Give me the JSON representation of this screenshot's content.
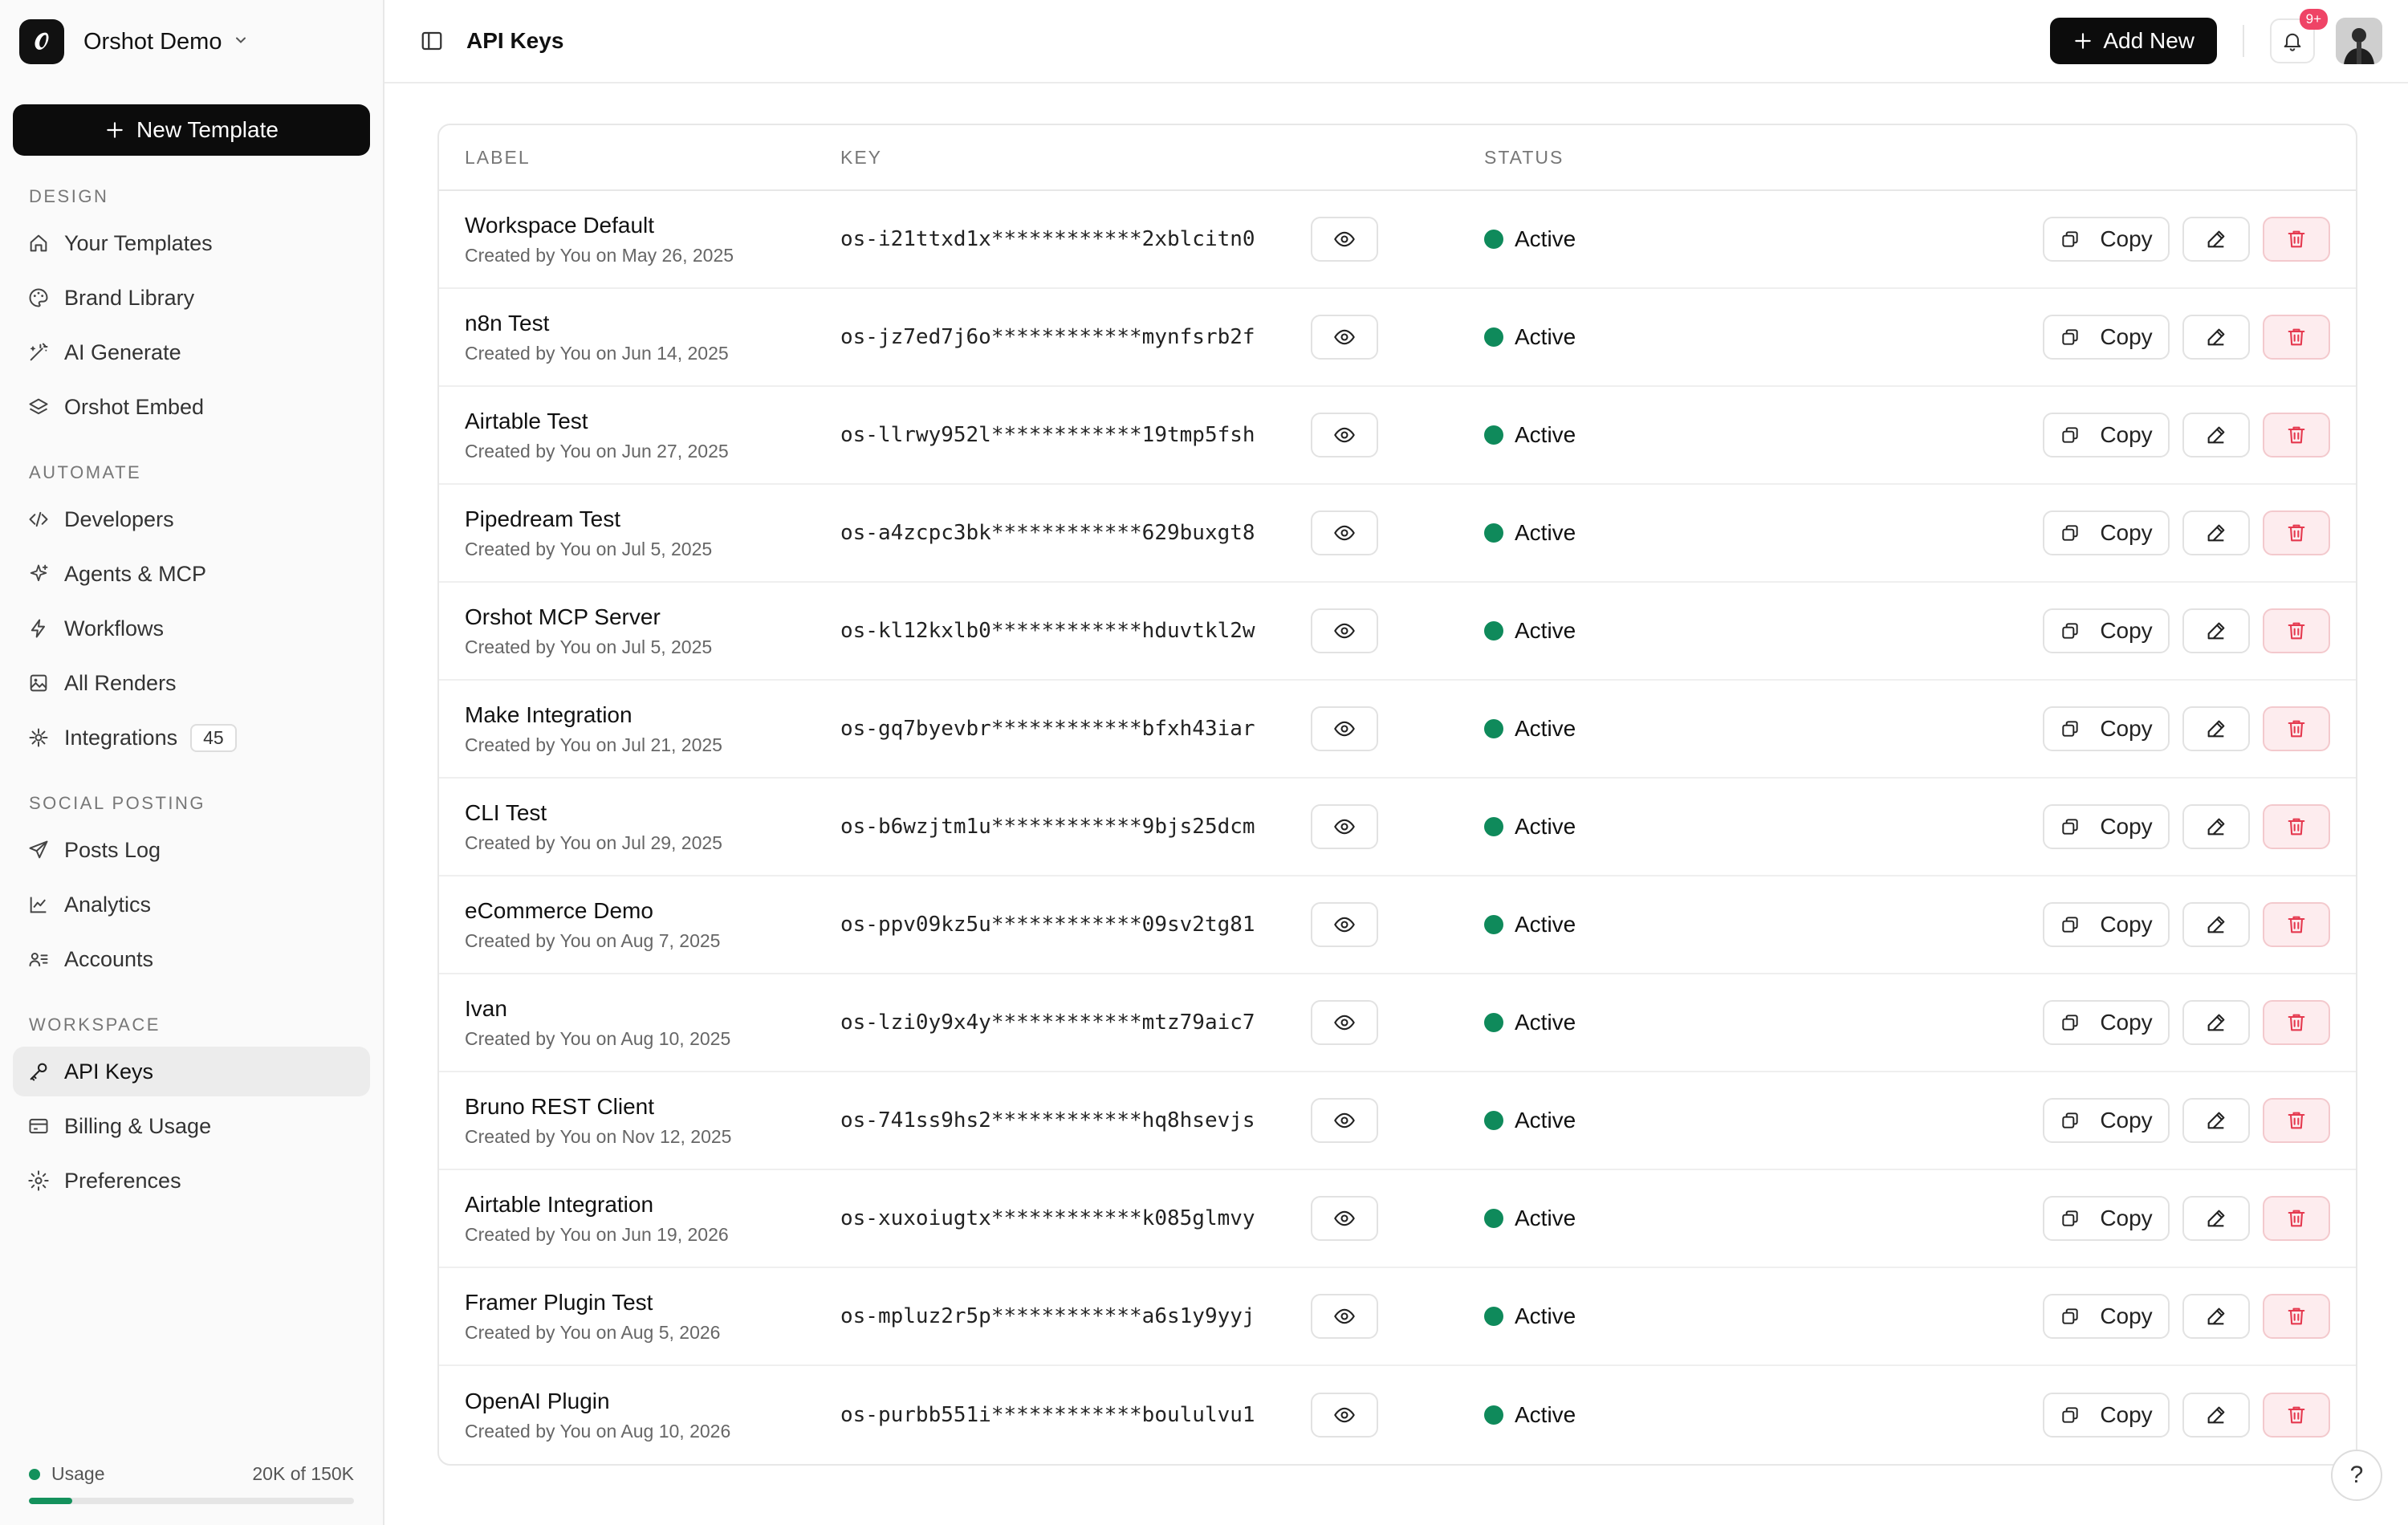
{
  "workspace": {
    "name": "Orshot Demo"
  },
  "sidebar": {
    "new_template_label": "New Template",
    "sections": [
      {
        "title": "DESIGN",
        "items": [
          {
            "label": "Your Templates",
            "icon": "home-icon"
          },
          {
            "label": "Brand Library",
            "icon": "palette-icon"
          },
          {
            "label": "AI Generate",
            "icon": "wand-icon"
          },
          {
            "label": "Orshot Embed",
            "icon": "layers-icon"
          }
        ]
      },
      {
        "title": "AUTOMATE",
        "items": [
          {
            "label": "Developers",
            "icon": "code-icon"
          },
          {
            "label": "Agents & MCP",
            "icon": "sparkles-icon"
          },
          {
            "label": "Workflows",
            "icon": "zap-icon"
          },
          {
            "label": "All Renders",
            "icon": "image-icon"
          },
          {
            "label": "Integrations",
            "icon": "plug-icon",
            "badge": "45"
          }
        ]
      },
      {
        "title": "SOCIAL POSTING",
        "items": [
          {
            "label": "Posts Log",
            "icon": "send-icon"
          },
          {
            "label": "Analytics",
            "icon": "chart-icon"
          },
          {
            "label": "Accounts",
            "icon": "users-icon"
          }
        ]
      },
      {
        "title": "WORKSPACE",
        "items": [
          {
            "label": "API Keys",
            "icon": "key-icon",
            "active": true
          },
          {
            "label": "Billing & Usage",
            "icon": "card-icon"
          },
          {
            "label": "Preferences",
            "icon": "gear-icon"
          }
        ]
      }
    ],
    "usage": {
      "label": "Usage",
      "value_text": "20K of 150K",
      "fraction": 0.133
    }
  },
  "header": {
    "title": "API Keys",
    "add_new_label": "Add New",
    "notification_badge": "9+"
  },
  "table": {
    "columns": {
      "label": "LABEL",
      "key": "KEY",
      "status": "STATUS"
    },
    "copy_label": "Copy",
    "rows": [
      {
        "name": "Workspace Default",
        "created": "Created by You on May 26, 2025",
        "key": "os-i21ttxd1x************2xblcitn0",
        "status": "Active"
      },
      {
        "name": "n8n Test",
        "created": "Created by You on Jun 14, 2025",
        "key": "os-jz7ed7j6o************mynfsrb2f",
        "status": "Active"
      },
      {
        "name": "Airtable Test",
        "created": "Created by You on Jun 27, 2025",
        "key": "os-llrwy952l************19tmp5fsh",
        "status": "Active"
      },
      {
        "name": "Pipedream Test",
        "created": "Created by You on Jul 5, 2025",
        "key": "os-a4zcpc3bk************629buxgt8",
        "status": "Active"
      },
      {
        "name": "Orshot MCP Server",
        "created": "Created by You on Jul 5, 2025",
        "key": "os-kl12kxlb0************hduvtkl2w",
        "status": "Active"
      },
      {
        "name": "Make Integration",
        "created": "Created by You on Jul 21, 2025",
        "key": "os-gq7byevbr************bfxh43iar",
        "status": "Active"
      },
      {
        "name": "CLI Test",
        "created": "Created by You on Jul 29, 2025",
        "key": "os-b6wzjtm1u************9bjs25dcm",
        "status": "Active"
      },
      {
        "name": "eCommerce Demo",
        "created": "Created by You on Aug 7, 2025",
        "key": "os-ppv09kz5u************09sv2tg81",
        "status": "Active"
      },
      {
        "name": "Ivan",
        "created": "Created by You on Aug 10, 2025",
        "key": "os-lzi0y9x4y************mtz79aic7",
        "status": "Active"
      },
      {
        "name": "Bruno REST Client",
        "created": "Created by You on Nov 12, 2025",
        "key": "os-741ss9hs2************hq8hsevjs",
        "status": "Active"
      },
      {
        "name": "Airtable Integration",
        "created": "Created by You on Jun 19, 2026",
        "key": "os-xuxoiugtx************k085glmvy",
        "status": "Active"
      },
      {
        "name": "Framer Plugin Test",
        "created": "Created by You on Aug 5, 2026",
        "key": "os-mpluz2r5p************a6s1y9yyj",
        "status": "Active"
      },
      {
        "name": "OpenAI Plugin",
        "created": "Created by You on Aug 10, 2026",
        "key": "os-purbb551i************boululvu1",
        "status": "Active"
      }
    ]
  },
  "help_label": "?",
  "colors": {
    "accent": "#0c0c0c",
    "status_active": "#0f8a5b",
    "delete_bg": "#fdecee",
    "delete_icon": "#e5394f",
    "badge": "#ef4466"
  }
}
